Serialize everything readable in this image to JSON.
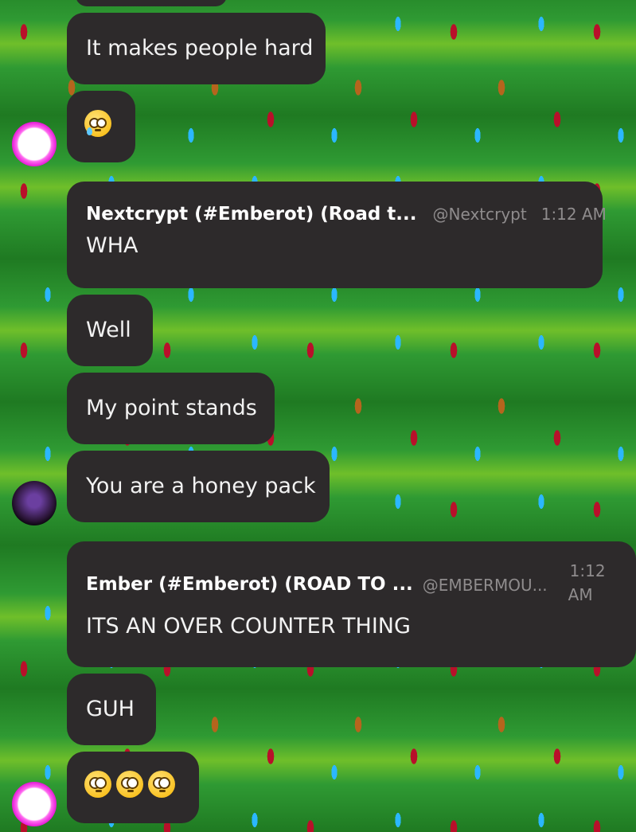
{
  "messages": [
    {
      "text": "It makes people hard"
    },
    {
      "emoji": "🥲"
    },
    {
      "author": "Nextcrypt (#Emberot) (Road t...",
      "handle": "@Nextcrypt",
      "time": "1:12 AM",
      "text": "WHA"
    },
    {
      "text": "Well"
    },
    {
      "text": "My point stands"
    },
    {
      "text": "You are a honey pack"
    },
    {
      "author": "Ember (#Emberot) (ROAD TO ...",
      "handle": "@EMBERMOU...",
      "time_line1": "1:12",
      "time_line2": "AM",
      "text": "ITS AN OVER COUNTER THING"
    },
    {
      "text": "GUH"
    },
    {
      "emoji": "😳😳😳"
    }
  ],
  "avatars": [
    {
      "icon": "pink-alien-avatar"
    },
    {
      "icon": "purple-character-avatar"
    },
    {
      "icon": "pink-alien-avatar"
    }
  ],
  "colors": {
    "bubble": "#2d2a2b",
    "text": "#f2f2f2",
    "muted": "#8f8c8d"
  }
}
